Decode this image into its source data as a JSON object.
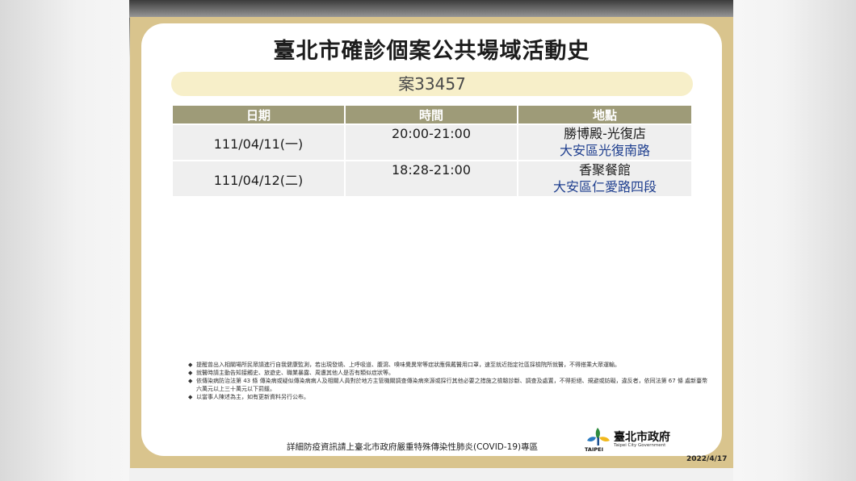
{
  "title": "臺北市確診個案公共場域活動史",
  "case_label": "案33457",
  "table": {
    "headers": [
      "日期",
      "時間",
      "地點"
    ],
    "rows": [
      {
        "date": "111/04/11(一)",
        "time": "20:00-21:00",
        "place": "勝博殿-光復店",
        "address": "大安區光復南路"
      },
      {
        "date": "111/04/12(二)",
        "time": "18:28-21:00",
        "place": "香聚餐館",
        "address": "大安區仁愛路四段"
      }
    ]
  },
  "notes": [
    "提醒曾出入相關場所民眾請進行自我健康監測，若出現發燒、上呼吸道、腹瀉、嗅味覺異常等症狀應佩戴醫用口罩，速至就近指定社區採檢院所就醫，不得搭乘大眾運輸。",
    "就醫時請主動告知接觸史、旅遊史、職業暴露、周遭其他人是否有類似症狀等。",
    "依傳染病防治法第 43 條 傳染病或疑似傳染病病人及相關人員對於地方主管機關調查傳染病來源或採行其他必要之措施之檢驗診斷、調查及處置，不得拒絕、規避或妨礙，違反者，依同法第 67 條 處新臺幣六萬元以上三十萬元以下罰鍰。",
    "以當事人陳述為主，如有更新資料另行公布。"
  ],
  "note_bullet": "◆",
  "footer": "詳細防疫資訊請上臺北市政府嚴重特殊傳染性肺炎(COVID-19)專區",
  "logo": {
    "cn": "臺北市政府",
    "en": "Taipei City Government",
    "mark": "TAIPEI"
  },
  "date_stamp": "2022/4/17",
  "colors": {
    "frame": "#d9c48d",
    "pill": "#f7efc9",
    "header": "#9e9b78",
    "address": "#1f3f8f"
  }
}
